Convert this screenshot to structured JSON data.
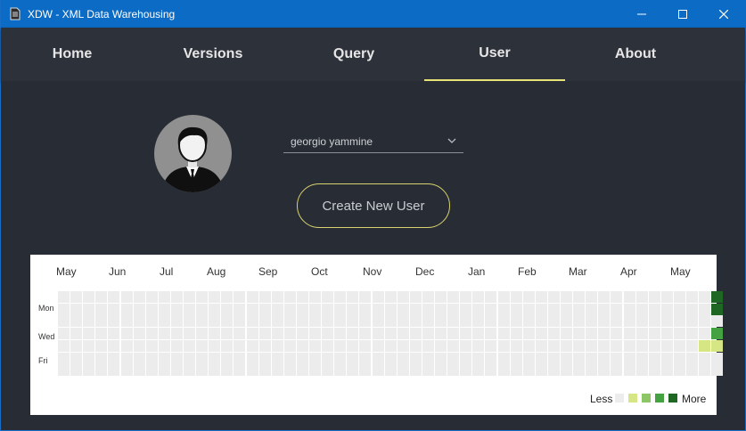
{
  "window": {
    "title": "XDW - XML Data Warehousing",
    "buttons": [
      "minimize-icon",
      "maximize-icon",
      "close-icon"
    ]
  },
  "nav": {
    "tabs": [
      {
        "label": "Home"
      },
      {
        "label": "Versions"
      },
      {
        "label": "Query"
      },
      {
        "label": "User"
      },
      {
        "label": "About"
      }
    ],
    "active": "User",
    "accent_color": "#e8e378"
  },
  "user": {
    "selected": "georgio yammine",
    "create_label": "Create New User",
    "avatar_icon": "user-avatar-icon"
  },
  "heatmap": {
    "months": [
      "May",
      "Jun",
      "Jul",
      "Aug",
      "Sep",
      "Oct",
      "Nov",
      "Dec",
      "Jan",
      "Feb",
      "Mar",
      "Apr",
      "May"
    ],
    "days": [
      "Mon",
      "Wed",
      "Fri"
    ],
    "weeks": 53,
    "rows": 7,
    "active_cells": [
      {
        "week": 52,
        "day": 0,
        "level": 4
      },
      {
        "week": 52,
        "day": 1,
        "level": 4
      },
      {
        "week": 52,
        "day": 3,
        "level": 3
      },
      {
        "week": 51,
        "day": 4,
        "level": 1
      },
      {
        "week": 52,
        "day": 4,
        "level": 1
      }
    ],
    "legend": {
      "less": "Less",
      "more": "More"
    },
    "colors": [
      "#ececec",
      "#d6e685",
      "#8cc665",
      "#44a340",
      "#1e6823"
    ]
  }
}
